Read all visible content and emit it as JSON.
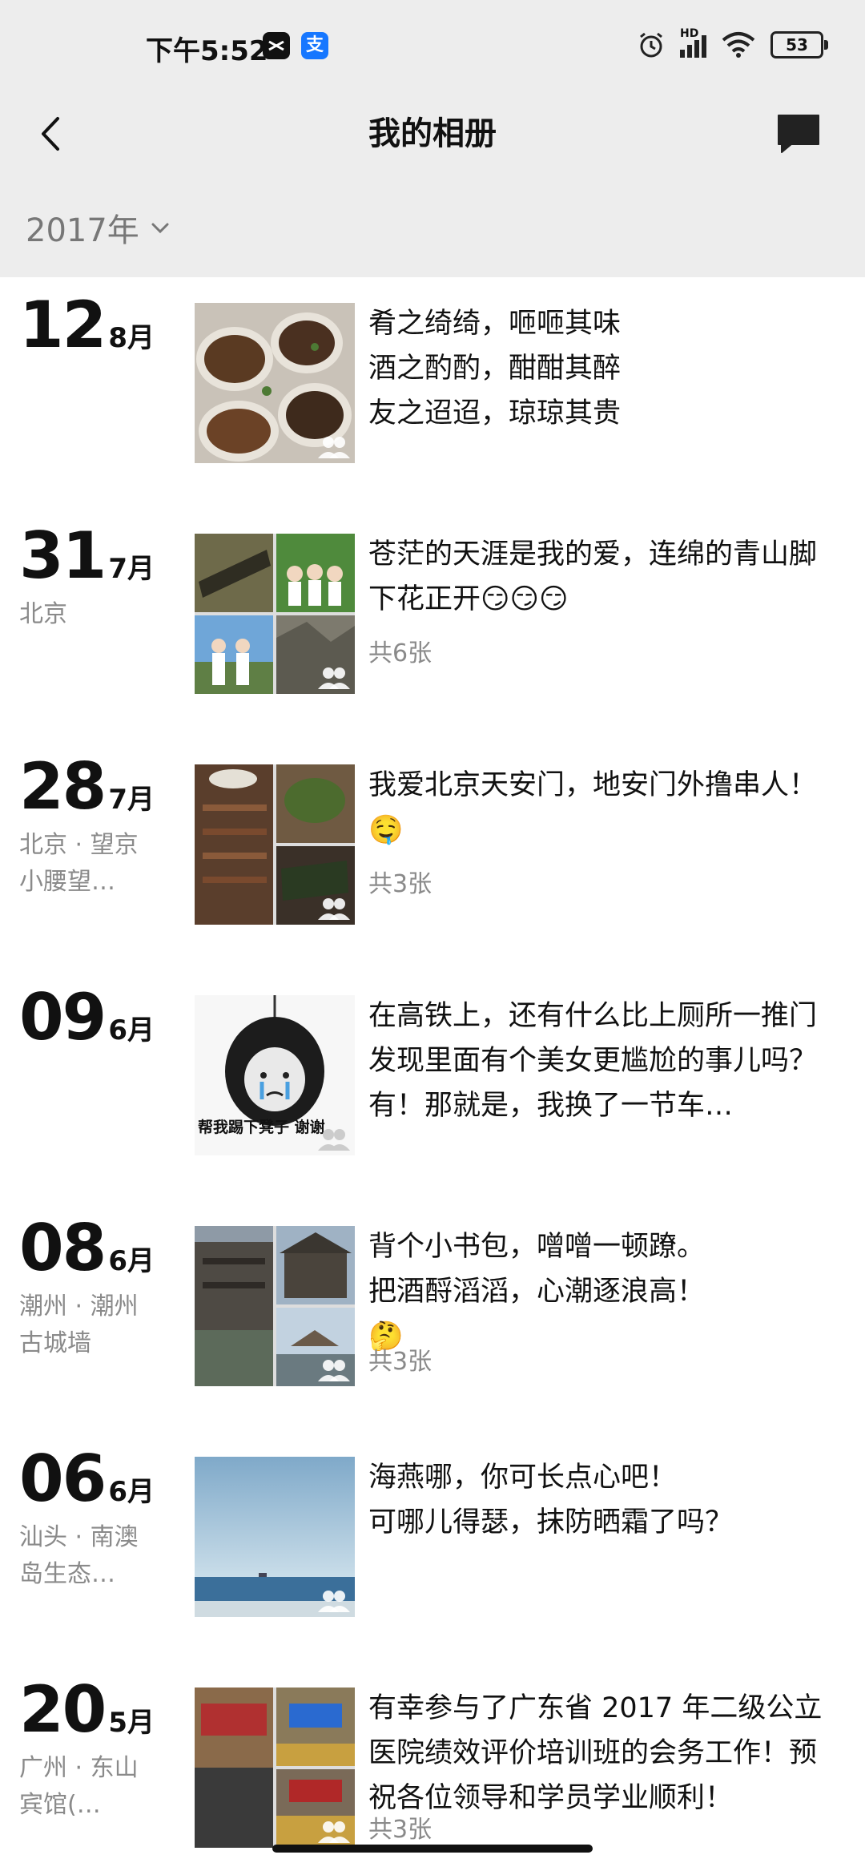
{
  "status_bar": {
    "time": "下午5:52",
    "app_icon_1": "capcut-icon",
    "app_icon_2": "alipay-icon",
    "app_icon_2_glyph": "支",
    "signal_label": "HD",
    "battery": "53"
  },
  "header": {
    "title": "我的相册",
    "back_icon": "back-chevron-icon",
    "message_icon": "message-bubble-icon"
  },
  "year_filter": {
    "label": "2017年",
    "icon": "chevron-down-icon"
  },
  "entries": [
    {
      "day": "12",
      "month": "8月",
      "location": "",
      "text": "肴之绮绮，咂咂其味\n酒之酌酌，酣酣其醉\n友之迢迢，琼琼其贵",
      "count": "",
      "thumb": "single"
    },
    {
      "day": "31",
      "month": "7月",
      "location": "北京",
      "text": "苍茫的天涯是我的爱，连绵的青山脚下花正开😏😏😏",
      "count": "共6张",
      "thumb": "grid"
    },
    {
      "day": "28",
      "month": "7月",
      "location": "北京 · 望京小腰望…",
      "text": "我爱北京天安门，地安门外撸串人！🤤",
      "count": "共3张",
      "thumb": "grid3"
    },
    {
      "day": "09",
      "month": "6月",
      "location": "",
      "text": "在高铁上，还有什么比上厕所一推门发现里面有个美女更尴尬的事儿吗？有！那就是，我换了一节车…",
      "count": "",
      "thumb": "meme",
      "meme_caption": "帮我踢下凳子 谢谢"
    },
    {
      "day": "08",
      "month": "6月",
      "location": "潮州 · 潮州古城墙",
      "text": "背个小书包，噌噌一顿蹽。\n把酒酹滔滔，心潮逐浪高！\n🤔",
      "count": "共3张",
      "thumb": "grid3"
    },
    {
      "day": "06",
      "month": "6月",
      "location": "汕头 · 南澳岛生态…",
      "text": "海燕哪，你可长点心吧！\n可哪儿得瑟，抹防晒霜了吗？",
      "count": "",
      "thumb": "sea"
    },
    {
      "day": "20",
      "month": "5月",
      "location": "广州 · 东山宾馆(…",
      "text": "有幸参与了广东省 2017 年二级公立医院绩效评价培训班的会务工作！预祝各位领导和学员学业顺利！",
      "count": "共3张",
      "thumb": "grid3"
    }
  ],
  "colors": {
    "header_bg": "#ededed",
    "secondary_text": "#8a8a8a",
    "alipay_blue": "#1677ff"
  }
}
